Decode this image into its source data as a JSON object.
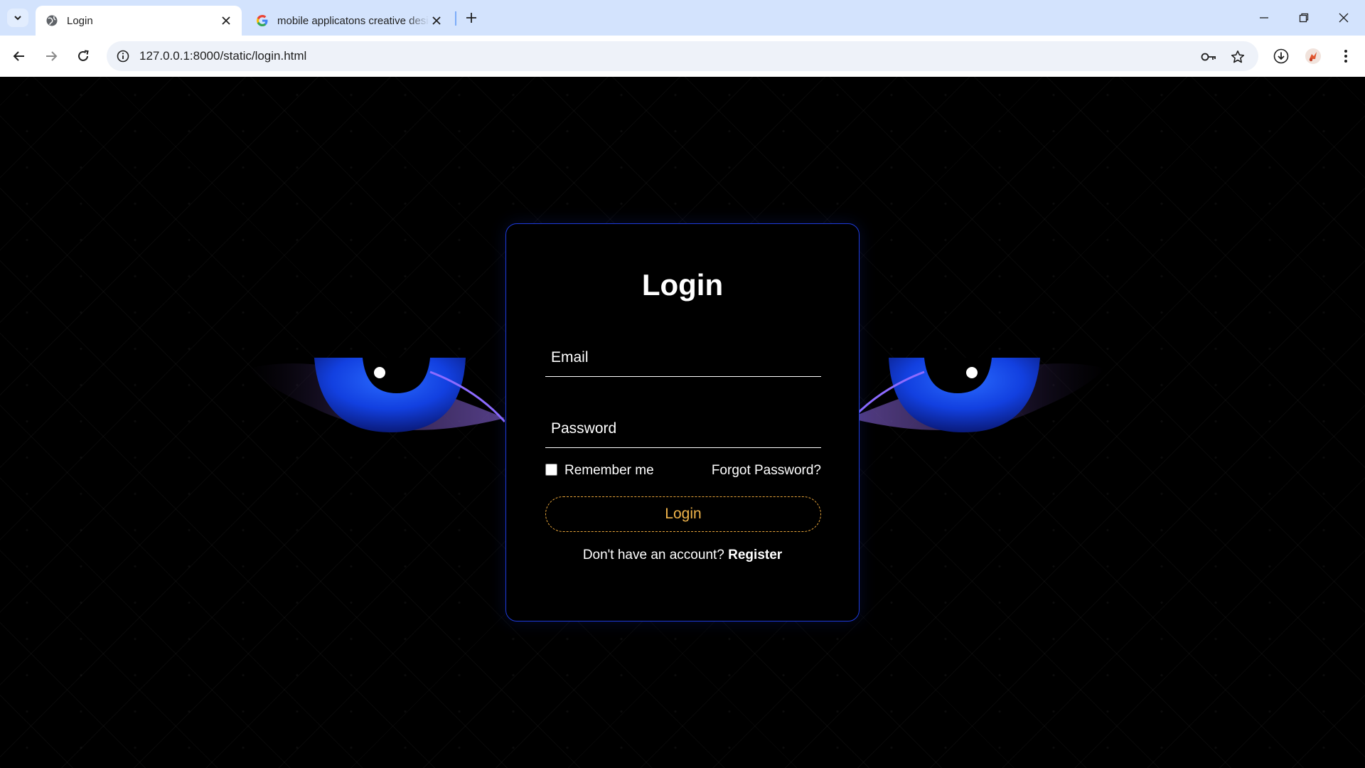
{
  "browser": {
    "tabs": [
      {
        "title": "Login",
        "active": true
      },
      {
        "title": "mobile applicatons creative design",
        "active": false
      }
    ],
    "address": "127.0.0.1:8000/static/login.html"
  },
  "login": {
    "title": "Login",
    "email_placeholder": "Email",
    "password_placeholder": "Password",
    "remember_label": "Remember me",
    "forgot_label": "Forgot Password?",
    "button_label": "Login",
    "no_account_text": "Don't have an account? ",
    "register_label": "Register"
  },
  "colors": {
    "card_border": "#1e3bdc",
    "button_accent": "#f0b44a",
    "eye_blue": "#1a4cff"
  }
}
